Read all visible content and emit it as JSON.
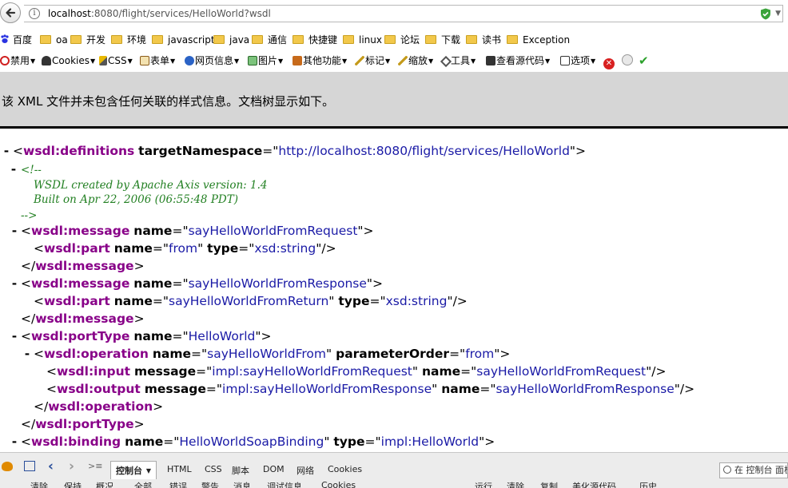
{
  "browser": {
    "url_host": "localhost",
    "url_rest": ":8080/flight/services/HelloWorld?wsdl"
  },
  "bookmarks": [
    "百度",
    "oa",
    "开发",
    "环境",
    "javascript",
    "java",
    "通信",
    "快捷键",
    "linux",
    "论坛",
    "下载",
    "读书",
    "Exception"
  ],
  "toolbar": {
    "items": [
      "禁用",
      "Cookies",
      "CSS",
      "表单",
      "网页信息",
      "图片",
      "其他功能",
      "标记",
      "缩放",
      "工具",
      "查看源代码",
      "选项"
    ]
  },
  "notice": "该 XML 文件并未包含任何关联的样式信息。文档树显示如下。",
  "xml": {
    "definitions_tag": "wsdl:definitions",
    "targetNamespace_attr": "targetNamespace",
    "targetNamespace_val": "http://localhost:8080/flight/services/HelloWorld",
    "comment_open": "<!--",
    "comment_line1": "WSDL created by Apache Axis version: 1.4",
    "comment_line2": "Built on Apr 22, 2006 (06:55:48 PDT)",
    "comment_close": "-->",
    "message_tag": "wsdl:message",
    "part_tag": "wsdl:part",
    "name_attr": "name",
    "type_attr": "type",
    "msg1_name": "sayHelloWorldFromRequest",
    "part1_name": "from",
    "part1_type": "xsd:string",
    "msg2_name": "sayHelloWorldFromResponse",
    "part2_name": "sayHelloWorldFromReturn",
    "part2_type": "xsd:string",
    "portType_tag": "wsdl:portType",
    "portType_name": "HelloWorld",
    "operation_tag": "wsdl:operation",
    "operation_name": "sayHelloWorldFrom",
    "parameterOrder_attr": "parameterOrder",
    "parameterOrder_val": "from",
    "input_tag": "wsdl:input",
    "output_tag": "wsdl:output",
    "message_attr": "message",
    "input_message": "impl:sayHelloWorldFromRequest",
    "input_name": "sayHelloWorldFromRequest",
    "output_message": "impl:sayHelloWorldFromResponse",
    "output_name": "sayHelloWorldFromResponse",
    "binding_tag": "wsdl:binding",
    "binding_name": "HelloWorldSoapBinding",
    "binding_type": "impl:HelloWorld"
  },
  "devtools": {
    "tabs": [
      "控制台",
      "HTML",
      "CSS",
      "脚本",
      "DOM",
      "网络",
      "Cookies"
    ],
    "search_placeholder": "在 控制台 面板",
    "row2": [
      "清除",
      "保持",
      "概况",
      "全部",
      "错误",
      "警告",
      "消息",
      "调试信息",
      "Cookies",
      "运行",
      "清除",
      "复制",
      "美化源代码",
      "历史"
    ]
  },
  "colors": {
    "tag": "#880088",
    "value": "#1a1aa6",
    "comment": "#238023",
    "notice_bg": "#d6d6d6"
  }
}
